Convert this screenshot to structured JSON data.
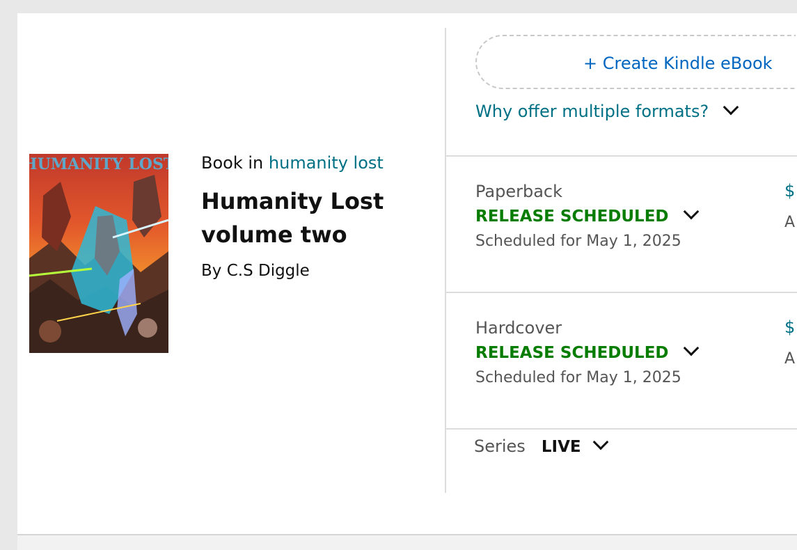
{
  "book": {
    "type_prefix": "Book in",
    "series_name": "humanity lost",
    "title": "Humanity Lost volume two",
    "author": "By C.S Diggle",
    "cover_text": "HUMANITY LOST"
  },
  "formats_panel": {
    "create_ebook_label": "+ Create Kindle eBook",
    "why_formats_label": "Why offer multiple formats?",
    "formats": [
      {
        "name": "Paperback",
        "status": "RELEASE SCHEDULED",
        "scheduled": "Scheduled for May 1, 2025",
        "price_glyph": "$",
        "aux_glyph": "A"
      },
      {
        "name": "Hardcover",
        "status": "RELEASE SCHEDULED",
        "scheduled": "Scheduled for May 1, 2025",
        "price_glyph": "$",
        "aux_glyph": "A"
      }
    ],
    "series": {
      "label": "Series",
      "status": "LIVE"
    }
  },
  "colors": {
    "link_teal": "#007185",
    "link_blue": "#0066c0",
    "status_green": "#067d00"
  },
  "icons": {
    "dropdown": "chevron-down-icon"
  }
}
